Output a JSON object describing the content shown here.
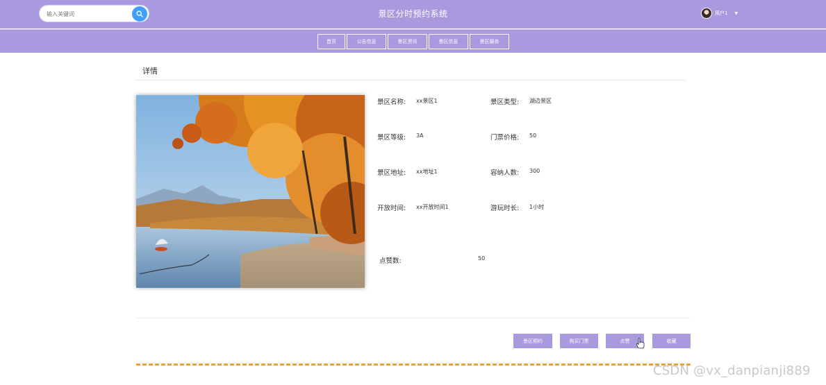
{
  "header": {
    "search_placeholder": "输入关键词",
    "site_title": "景区分时预约系统",
    "user_name": "用户1",
    "user_caret": "▼"
  },
  "nav": {
    "items": [
      {
        "label": "首页"
      },
      {
        "label": "公告信息"
      },
      {
        "label": "景区资讯"
      },
      {
        "label": "景区信息"
      },
      {
        "label": "景区服务"
      }
    ]
  },
  "section": {
    "title": "详情"
  },
  "details": {
    "name_label": "景区名称:",
    "name_value": "xx景区1",
    "type_label": "景区类型:",
    "type_value": "湖边景区",
    "level_label": "景区等级:",
    "level_value": "3A",
    "price_label": "门票价格:",
    "price_value": "50",
    "address_label": "景区地址:",
    "address_value": "xx地址1",
    "capacity_label": "容纳人数:",
    "capacity_value": "300",
    "open_label": "开放时间:",
    "open_value": "xx开放时间1",
    "duration_label": "游玩时长:",
    "duration_value": "1小时",
    "likes_label": "点赞数:",
    "likes_value": "50"
  },
  "actions": {
    "reserve": "景区预约",
    "buy": "购买门票",
    "like": "点赞",
    "favorite": "收藏"
  },
  "watermark": "CSDN @vx_danpianji889",
  "colors": {
    "header_bg": "#a99ae0",
    "search_button": "#409eff",
    "dashed_line": "#e6a23c"
  }
}
